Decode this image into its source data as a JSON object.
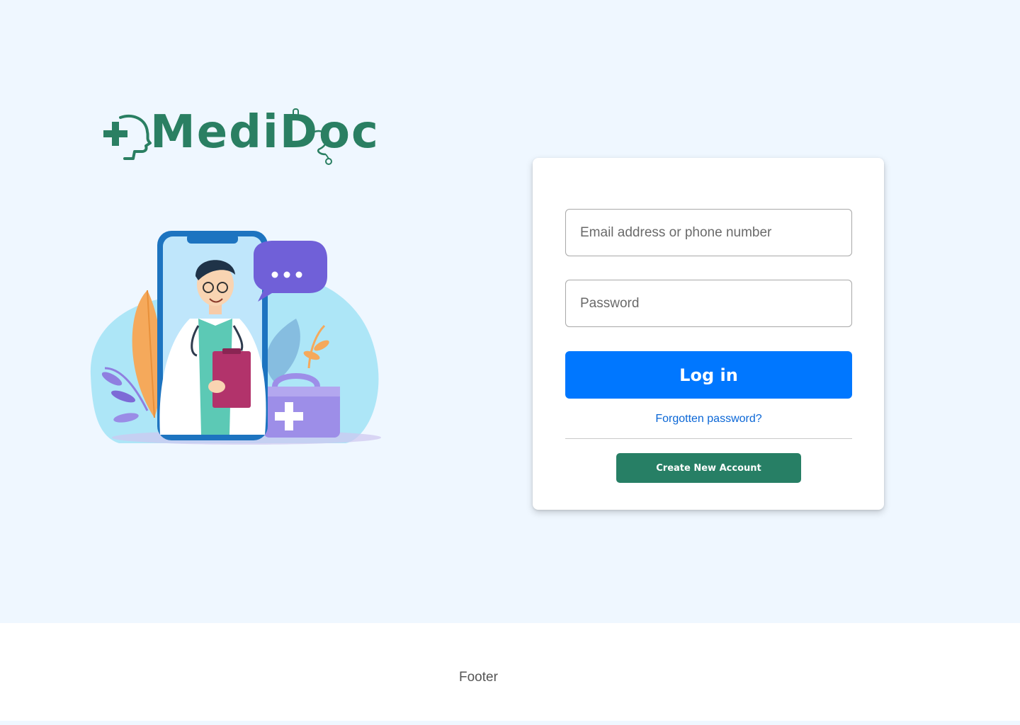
{
  "brand": {
    "logo_text": "MediDoc",
    "brand_color": "#2a7f62"
  },
  "login_form": {
    "email_placeholder": "Email address or phone number",
    "password_placeholder": "Password",
    "login_label": "Log in",
    "forgot_label": "Forgotten password?",
    "create_account_label": "Create New Account",
    "login_button_color": "#0077ff",
    "create_button_color": "#277f65"
  },
  "footer": {
    "text": "Footer"
  },
  "icons": {
    "logo": "medical-cross-head-stethoscope-icon",
    "illustration": "doctor-on-phone-illustration"
  }
}
